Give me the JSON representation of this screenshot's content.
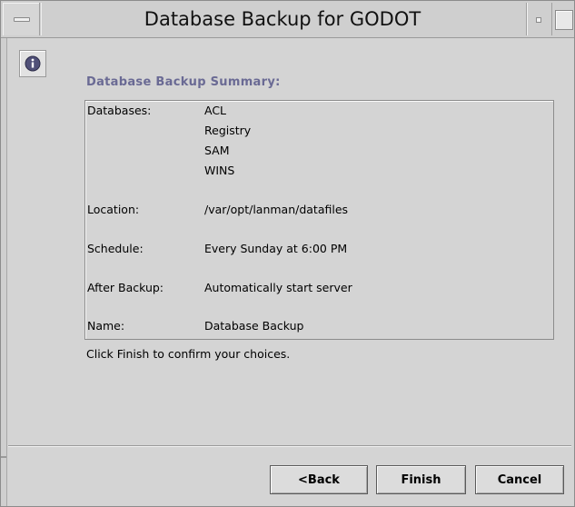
{
  "window": {
    "title": "Database Backup for GODOT"
  },
  "icons": {
    "window_menu": "window-menu-icon",
    "minimize": "minimize-icon",
    "maximize": "maximize-icon",
    "info": "info-icon"
  },
  "colors": {
    "heading": "#6a6a94",
    "background": "#d4d4d4",
    "info_icon": "#505078"
  },
  "summary": {
    "heading": "Database Backup Summary:",
    "databases_label": "Databases:",
    "databases": [
      "ACL",
      "Registry",
      "SAM",
      "WINS"
    ],
    "location_label": "Location:",
    "location": "/var/opt/lanman/datafiles",
    "schedule_label": "Schedule:",
    "schedule": "Every Sunday at 6:00 PM",
    "after_backup_label": "After Backup:",
    "after_backup": "Automatically start server",
    "name_label": "Name:",
    "name": "Database Backup"
  },
  "instructions": "Click Finish to confirm your choices.",
  "buttons": {
    "back": "<Back",
    "finish": "Finish",
    "cancel": "Cancel"
  }
}
